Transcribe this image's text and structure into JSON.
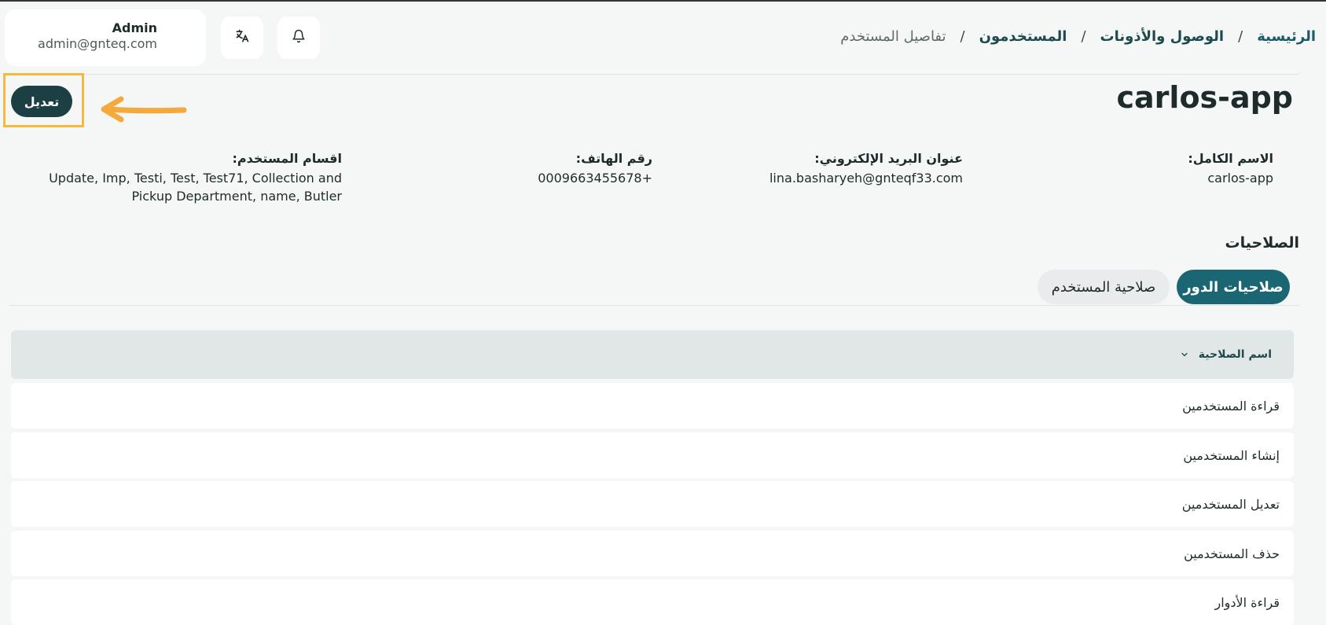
{
  "header": {
    "user_name": "Admin",
    "user_email": "admin@gnteq.com",
    "breadcrumb": {
      "home": "الرئيسية",
      "access": "الوصول والأذونات",
      "users": "المستخدمون",
      "current": "تفاصيل المستخدم",
      "separator": "/"
    }
  },
  "page": {
    "title": "carlos-app",
    "edit_label": "تعديل"
  },
  "details": {
    "full_name_label": "الاسم الكامل:",
    "full_name": "carlos-app",
    "email_label": "عنوان البريد الإلكتروني:",
    "email": "lina.basharyeh@gnteqf33.com",
    "phone_label": "رقم الهاتف:",
    "phone": "+0009663455678",
    "departments_label": "اقسام المستخدم:",
    "departments_line1": "Update, Imp, Testi, Test, Test71, Collection and",
    "departments_line2": "Pickup Department, name, Butler"
  },
  "permissions": {
    "title": "الصلاحيات",
    "tabs": [
      {
        "label": "صلاحيات الدور",
        "active": true
      },
      {
        "label": "صلاحية المستخدم",
        "active": false
      }
    ],
    "column_header": "اسم الصلاحية",
    "rows": [
      "قراءة المستخدمين",
      "إنشاء المستخدمين",
      "تعديل المستخدمين",
      "حذف المستخدمين",
      "قراءة الأدوار"
    ]
  },
  "colors": {
    "accent": "#1b6673",
    "edit_button": "#1c3f43",
    "highlight": "#f4b942"
  },
  "icons": {
    "translate": "translate-icon",
    "bell": "bell-icon",
    "chevron": "chevron-down-icon",
    "arrow": "arrow-left-icon"
  }
}
